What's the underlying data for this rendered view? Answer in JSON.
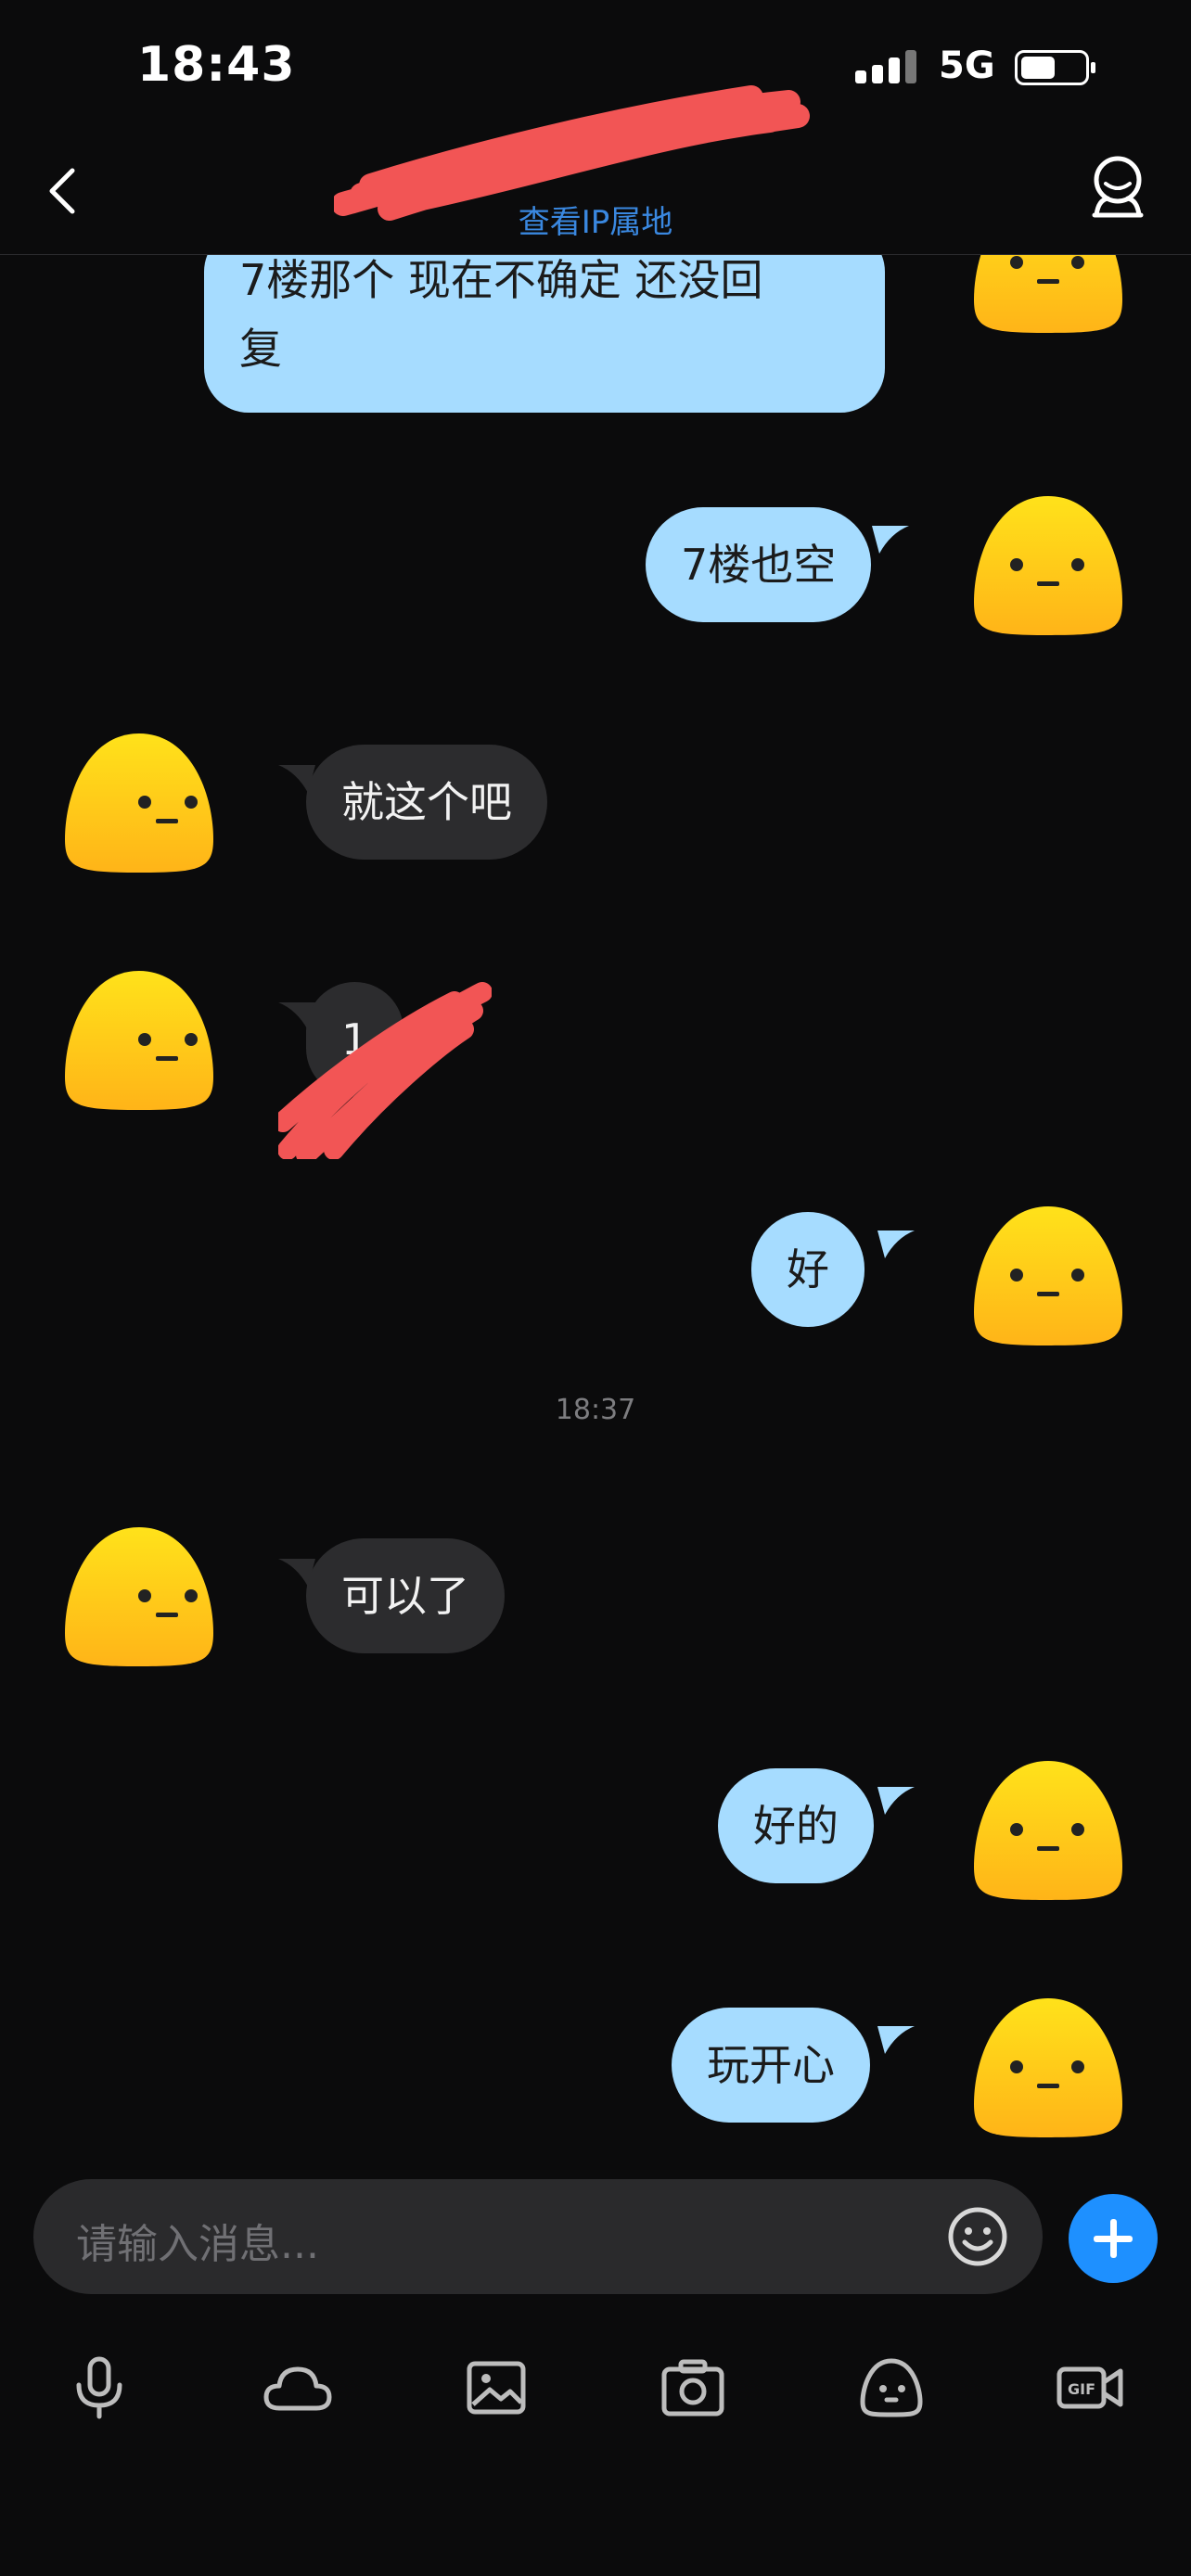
{
  "status_bar": {
    "time": "18:43",
    "network": "5G",
    "battery_level": 0.55
  },
  "nav": {
    "subtitle": "查看IP属地",
    "back_icon": "chevron-left-icon",
    "profile_icon": "contact-profile-icon"
  },
  "messages": [
    {
      "side": "me",
      "text_line1": "7楼那个 现在不确定 还没回",
      "text_line2": "复"
    },
    {
      "side": "me",
      "text": "7楼也空"
    },
    {
      "side": "them",
      "text": "就这个吧"
    },
    {
      "side": "them",
      "text": "1",
      "redacted": true
    },
    {
      "side": "me",
      "text": "好"
    },
    {
      "type": "timestamp",
      "text": "18:37"
    },
    {
      "side": "them",
      "text": "可以了"
    },
    {
      "side": "me",
      "text": "好的"
    },
    {
      "side": "me",
      "text": "玩开心"
    }
  ],
  "composer": {
    "placeholder": "请输入消息...",
    "emoji_icon": "smiley-icon",
    "plus_icon": "plus-icon"
  },
  "toolbar": [
    "microphone-icon",
    "cloud-icon",
    "image-icon",
    "camera-icon",
    "sticker-face-icon",
    "gif-video-icon"
  ],
  "colors": {
    "my_bubble": "#a6dcff",
    "their_bubble": "#2c2c2e",
    "accent": "#1e90ff",
    "avatar": "#ffd21a"
  }
}
